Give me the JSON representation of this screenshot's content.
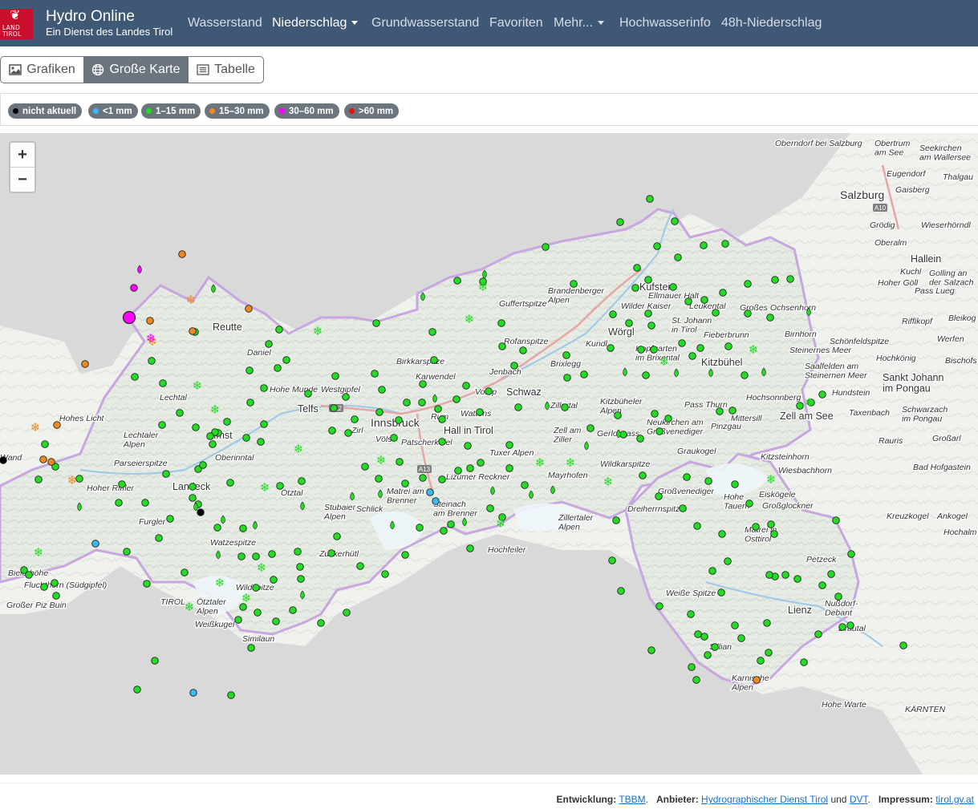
{
  "brand": {
    "logo_text_1": "LAND",
    "logo_text_2": "TIROL",
    "title": "Hydro Online",
    "subtitle": "Ein Dienst des Landes Tirol"
  },
  "nav": {
    "items": [
      {
        "label": "Wasserstand",
        "dropdown": false,
        "active": false
      },
      {
        "label": "Niederschlag",
        "dropdown": true,
        "active": true
      },
      {
        "label": "Grundwasserstand",
        "dropdown": false,
        "active": false
      },
      {
        "label": "Favoriten",
        "dropdown": false,
        "active": false
      },
      {
        "label": "Mehr...",
        "dropdown": true,
        "active": false
      },
      {
        "label": "Hochwasserinfo",
        "dropdown": false,
        "active": false
      },
      {
        "label": "48h-Niederschlag",
        "dropdown": false,
        "active": false
      }
    ]
  },
  "view_tabs": [
    {
      "label": "Grafiken",
      "icon": "image-icon",
      "active": false
    },
    {
      "label": "Große Karte",
      "icon": "globe-icon",
      "active": true
    },
    {
      "label": "Tabelle",
      "icon": "list-icon",
      "active": false
    }
  ],
  "legend": [
    {
      "label": "nicht aktuell",
      "color": "#000000"
    },
    {
      "label": "<1 mm",
      "color": "#3bb8f0"
    },
    {
      "label": "1–15 mm",
      "color": "#22dd22"
    },
    {
      "label": "15–30 mm",
      "color": "#f08a1e"
    },
    {
      "label": "30–60 mm",
      "color": "#ff00ff"
    },
    {
      "label": ">60 mm",
      "color": "#ee1111"
    }
  ],
  "map": {
    "zoom_in": "+",
    "zoom_out": "−",
    "cities": [
      "Reutte",
      "Imst",
      "Landeck",
      "Innsbruck",
      "Schwaz",
      "Kufstein",
      "Kitzbühel",
      "Lienz",
      "Salzburg",
      "Hallein",
      "Zell am See",
      "Sankt Johann im Pongau",
      "Hall in Tirol",
      "Wörgl",
      "Telfs"
    ],
    "places": [
      "Oberndorf bei Salzburg",
      "Obertrum am See",
      "Seekirchen am Wallersee",
      "Eugendorf",
      "Thalgau",
      "Gaisberg",
      "Grödig",
      "Wieserhörndl",
      "Oberalm",
      "Kuchl",
      "Golling an der Salzach",
      "Hoher Göll",
      "Pass Lueg",
      "Riffikopf",
      "Bleikog",
      "Werfen",
      "Hochkönig",
      "Bischofs",
      "Schwarzach im Pongau",
      "Großarl",
      "Rauris",
      "Bad Hofgastein",
      "Ankogel",
      "Kreuzkogel",
      "Hochalm",
      "Brandenberger Alpen",
      "Guffertspitze",
      "Ellmauer Halt",
      "Wilder Kaiser",
      "Leukental",
      "Großes Ochsenhorn",
      "St. Johann in Tirol",
      "Fieberbrunn",
      "Birnhorn",
      "Schönfeldspitze",
      "Steinernes Meer",
      "Saalfelden am Steinernen Meer",
      "Hundstein",
      "Taxenbach",
      "Hopfgarten im Brixental",
      "Kundl",
      "Brixlegg",
      "Rofanspitze",
      "Birkkarspitze",
      "Karwendel",
      "Jenbach",
      "Vomp",
      "Zillertal",
      "Kitzbüheler Alpen",
      "Pass Thurn",
      "Hochsonnberg",
      "Mittersill",
      "Pinzgau",
      "Neukirchen am Großvenediger",
      "Gerlospass",
      "Zell am Ziller",
      "Tuxer Alpen",
      "Mayrhofen",
      "Wildkarspitze",
      "Graukogel",
      "Kitzsteinhorn",
      "Wiesbachhorn",
      "Großvenediger",
      "Hohe Tauern",
      "Eiskögele",
      "Großglockner",
      "Dreiherrnspitze",
      "Zillertaler Alpen",
      "Hochfeiler",
      "Matrei in Osttirol",
      "Petzeck",
      "Weiße Spitze",
      "Nußdorf-Debant",
      "Drautal",
      "Sillian",
      "Karnische Alpen",
      "Hohe Warte",
      "KÄRNTEN",
      "Wattens",
      "Rum",
      "Patscherkofel",
      "Lizumer Reckner",
      "Matrei am Brenner",
      "Steinach am Brenner",
      "Stubaier Alpen",
      "Zuckerhütl",
      "Ötztal",
      "Ötztaler Alpen",
      "Wildspitze",
      "Weißkugel",
      "Similaun",
      "Watzespitze",
      "Hohe Munde",
      "Westgipfel",
      "Zirl",
      "Völs",
      "Oberinntal",
      "Parseierspitze",
      "Hoher Riffler",
      "Furgler",
      "Lechtal",
      "Lechtaler Alpen",
      "Hohes Licht",
      "Daniel",
      "Bielerhöhe",
      "Fluchthorn (Südgipfel)",
      "Großer Piz Buin",
      "Wand",
      "Schlick",
      "TIROL"
    ],
    "roads": [
      "A12",
      "A13",
      "A10"
    ]
  },
  "footer": {
    "dev_label": "Entwicklung:",
    "dev_link": "TBBM",
    "provider_label": "Anbieter:",
    "provider_link": "Hydrographischer Dienst Tirol",
    "and": "und",
    "provider_link2": "DVT",
    "imprint_label": "Impressum:",
    "imprint_link": "tirol.gv.at"
  }
}
